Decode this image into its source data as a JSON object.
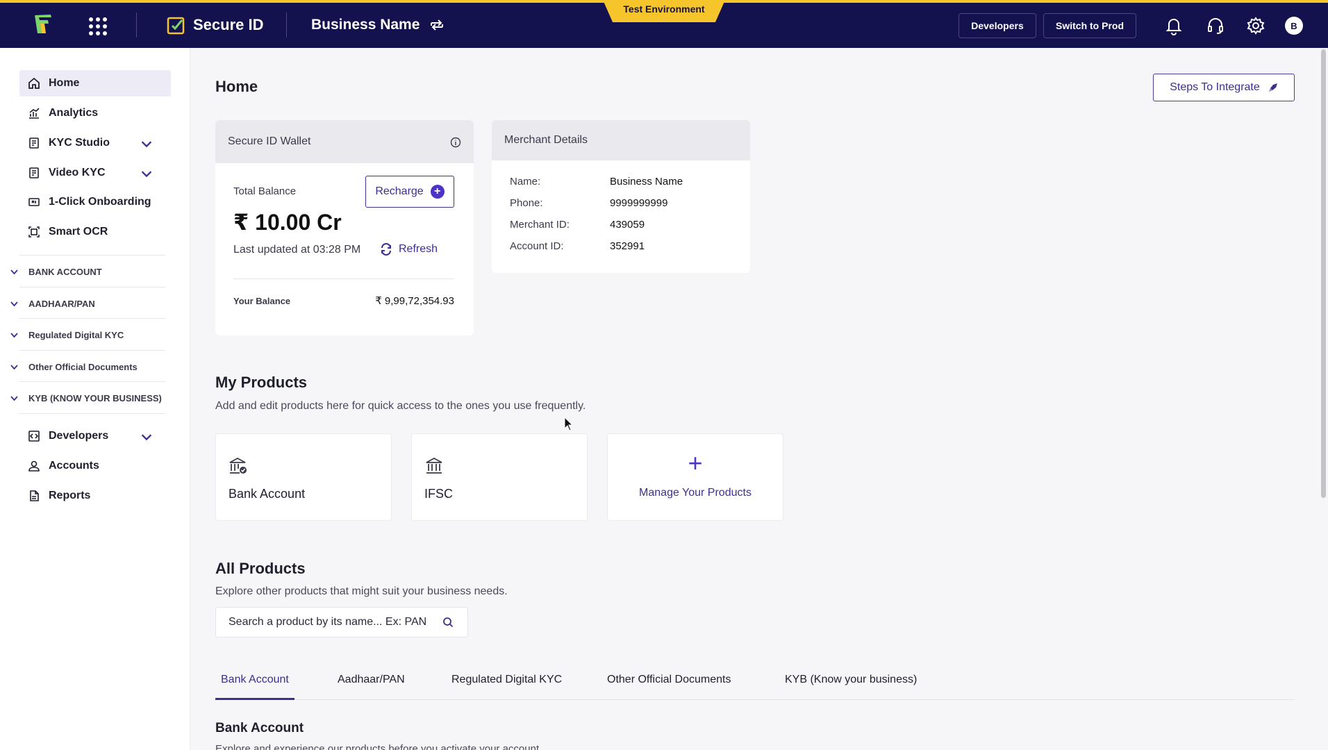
{
  "header": {
    "app_name": "Secure ID",
    "business_name": "Business Name",
    "environment": "Test Environment",
    "developers_label": "Developers",
    "switch_label": "Switch to Prod",
    "avatar_initial": "B",
    "brand_color": "#14114f",
    "accent_color": "#f5c52b"
  },
  "sidebar": {
    "items": [
      {
        "label": "Home",
        "icon": "home-icon"
      },
      {
        "label": "Analytics",
        "icon": "analytics-icon"
      },
      {
        "label": "KYC Studio",
        "icon": "kyc-studio-icon"
      },
      {
        "label": "Video KYC",
        "icon": "video-kyc-icon"
      },
      {
        "label": "1-Click Onboarding",
        "icon": "onboarding-icon"
      },
      {
        "label": "Smart OCR",
        "icon": "ocr-icon"
      }
    ],
    "sections": [
      "BANK ACCOUNT",
      "AADHAAR/PAN",
      "Regulated Digital KYC",
      "Other Official Documents",
      "KYB (KNOW YOUR BUSINESS)"
    ],
    "bottom_items": [
      {
        "label": "Developers",
        "icon": "code-icon"
      },
      {
        "label": "Accounts",
        "icon": "user-icon"
      },
      {
        "label": "Reports",
        "icon": "report-icon"
      }
    ]
  },
  "main": {
    "title": "Home",
    "steps_label": "Steps To Integrate",
    "wallet": {
      "title": "Secure ID Wallet",
      "total_balance_label": "Total Balance",
      "total_balance": "₹ 10.00 Cr",
      "recharge_label": "Recharge",
      "last_updated": "Last updated at 03:28 PM",
      "refresh_label": "Refresh",
      "your_balance_label": "Your Balance",
      "your_balance": "₹ 9,99,72,354.93"
    },
    "merchant": {
      "title": "Merchant Details",
      "rows": [
        {
          "label": "Name:",
          "value": "Business Name"
        },
        {
          "label": "Phone:",
          "value": "9999999999"
        },
        {
          "label": "Merchant ID:",
          "value": "439059"
        },
        {
          "label": "Account ID:",
          "value": "352991"
        }
      ]
    },
    "my_products": {
      "title": "My Products",
      "subtitle": "Add and edit products here for quick access to the ones you use frequently.",
      "items": [
        {
          "label": "Bank Account",
          "icon": "bank-verify-icon"
        },
        {
          "label": "IFSC",
          "icon": "bank-icon"
        }
      ],
      "manage_label": "Manage Your Products"
    },
    "all_products": {
      "title": "All Products",
      "subtitle": "Explore other products that might suit your business needs.",
      "search_placeholder": "Search a product by its name... Ex: PAN",
      "tabs": [
        "Bank Account",
        "Aadhaar/PAN",
        "Regulated Digital KYC",
        "Other Official Documents",
        "KYB (Know your business)"
      ],
      "active_tab": "Bank Account",
      "section_heading": "Bank Account",
      "section_sub": "Explore and experience our products before you activate your account"
    }
  }
}
